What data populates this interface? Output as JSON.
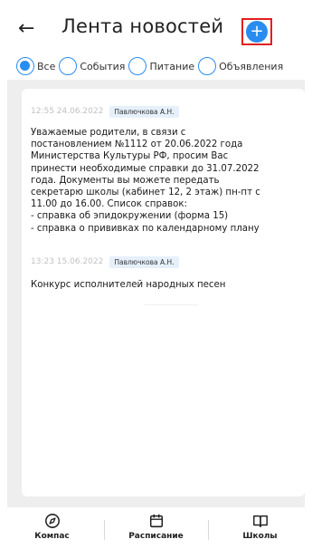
{
  "header": {
    "title": "Лента новостей",
    "back_icon": "arrow-left-icon",
    "add_icon": "plus-icon",
    "accent": "#2b8cf0",
    "highlight": "#e02020"
  },
  "filters": [
    {
      "label": "Все",
      "selected": true
    },
    {
      "label": "События",
      "selected": false
    },
    {
      "label": "Питание",
      "selected": false
    },
    {
      "label": "Объявления",
      "selected": false
    }
  ],
  "posts": [
    {
      "time": "12:55 24.06.2022",
      "author": "Павлючкова А.Н.",
      "text": "Уважаемые родители, в связи с\nпостановлением №1112 от 20.06.2022 года\nМинистерства Культуры РФ, просим Вас\nпринести необходимые справки до 31.07.2022\nгода. Документы вы можете передать\nсекретарю школы (кабинет 12, 2 этаж) пн-пт с\n11.00 до 16.00. Список справок:\n- справка об эпидокружении (форма 15)\n- справка о прививках по календарному плану"
    },
    {
      "time": "13:23 15.06.2022",
      "author": "Павлючкова А.Н.",
      "text": "Конкурс исполнителей народных песен"
    }
  ],
  "bottom_nav": [
    {
      "label": "Компас",
      "icon": "compass-icon"
    },
    {
      "label": "Расписание",
      "icon": "calendar-icon"
    },
    {
      "label": "Школы",
      "icon": "book-icon"
    }
  ]
}
